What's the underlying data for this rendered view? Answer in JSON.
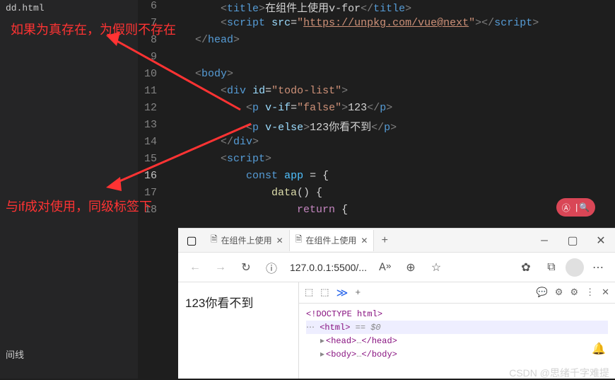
{
  "sidebar": {
    "file": "dd.html",
    "bottom": "间线"
  },
  "annotations": {
    "line1": "如果为真存在，为假则不存在",
    "line2": "与if成对使用，同级标签下"
  },
  "code": {
    "l6": {
      "num": "6",
      "title": "在组件上使用v-for"
    },
    "l7": {
      "num": "7",
      "src": "https://unpkg.com/vue@next"
    },
    "l8": {
      "num": "8"
    },
    "l9": {
      "num": "9"
    },
    "l10": {
      "num": "10"
    },
    "l11": {
      "num": "11",
      "id": "todo-list"
    },
    "l12": {
      "num": "12",
      "vif": "false",
      "text": "123"
    },
    "l13": {
      "num": "13",
      "text": "123你看不到"
    },
    "l14": {
      "num": "14"
    },
    "l15": {
      "num": "15"
    },
    "l16": {
      "num": "16",
      "const": "const",
      "app": "app"
    },
    "l17": {
      "num": "17",
      "data": "data"
    },
    "l18": {
      "num": "18",
      "return": "return"
    }
  },
  "browser": {
    "tab1": "在组件上使用",
    "tab2": "在组件上使用",
    "url": "127.0.0.1:5500/...",
    "page_text": "123你看不到"
  },
  "devtools": {
    "doctype": "<!DOCTYPE html>",
    "html_open": "<html>",
    "html_comment": "== $0",
    "head_open": "<head>",
    "head_dots": "…",
    "head_close": "</head>",
    "body_open": "<body>",
    "body_dots": "…",
    "body_close": "</body>"
  },
  "watermark": "CSDN @思绪千字难提"
}
